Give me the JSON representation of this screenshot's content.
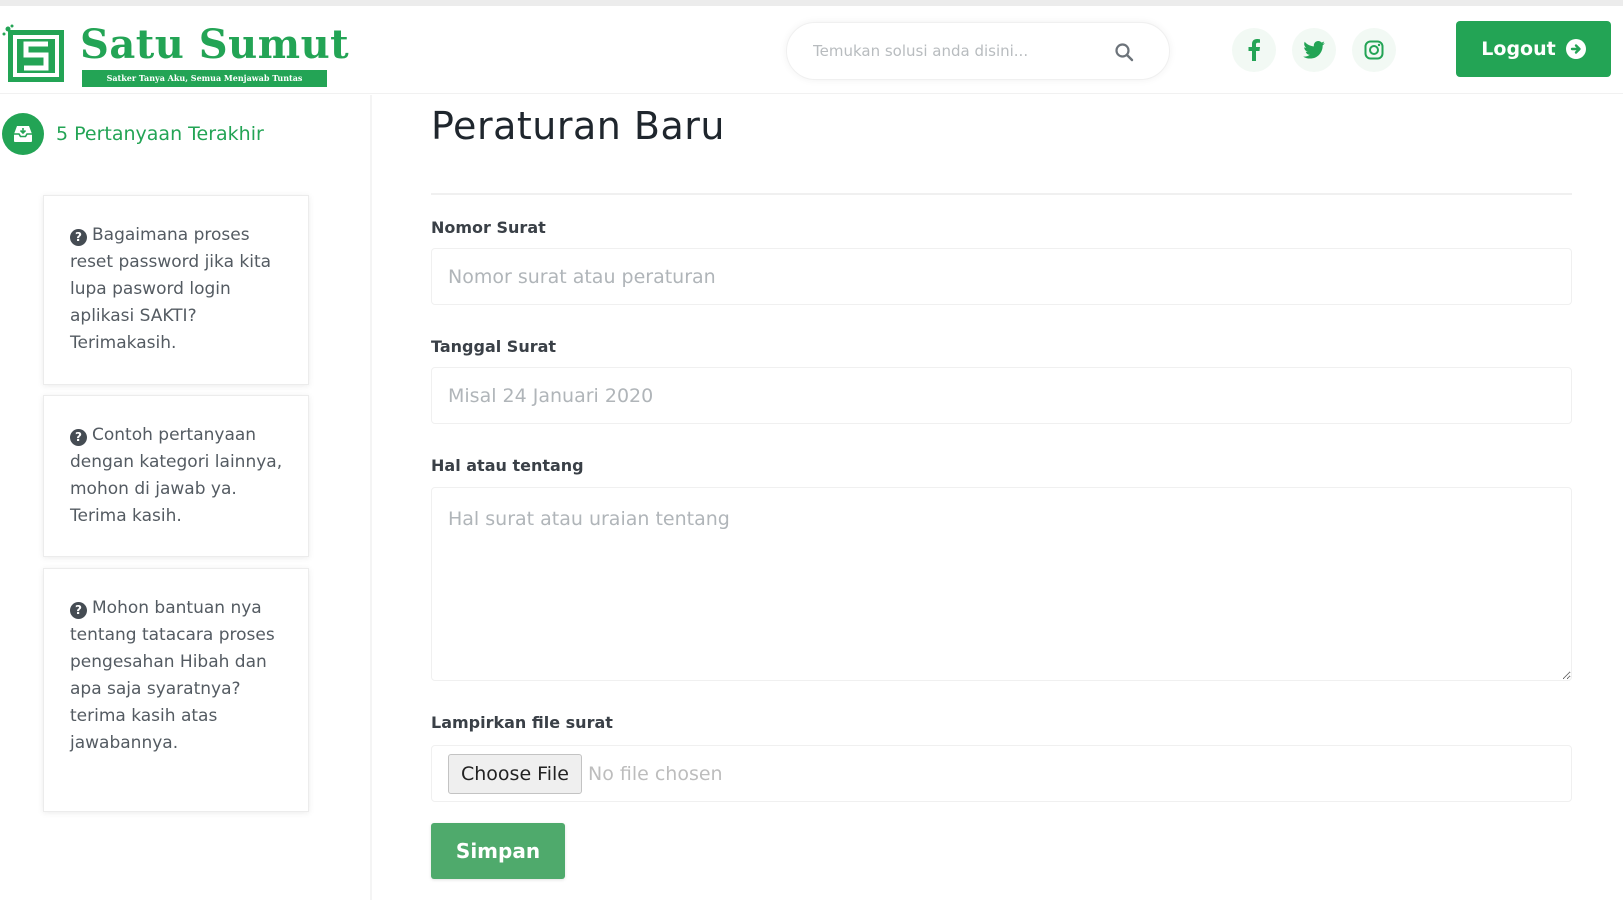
{
  "brand": {
    "title": "Satu Sumut",
    "tagline": "Satker Tanya Aku, Semua Menjawab Tuntas",
    "accent_color": "#23a455"
  },
  "header": {
    "search_placeholder": "Temukan solusi anda disini...",
    "search_icon": "search-icon",
    "social": [
      "facebook-icon",
      "twitter-icon",
      "instagram-icon"
    ],
    "logout_label": "Logout",
    "logout_icon": "arrow-circle-right-icon"
  },
  "sidebar": {
    "heading": "5 Pertanyaan Terakhir",
    "heading_icon": "inbox-icon",
    "questions": [
      "Bagaimana proses reset password jika kita lupa pasword login aplikasi SAKTI? Terimakasih.",
      "Contoh pertanyaan dengan kategori lainnya, mohon di jawab ya. Terima kasih.",
      "Mohon bantuan nya tentang tatacara proses pengesahan Hibah dan apa saja syaratnya? terima kasih atas jawabannya."
    ]
  },
  "form": {
    "title": "Peraturan Baru",
    "nomor_label": "Nomor Surat",
    "nomor_placeholder": "Nomor surat atau peraturan",
    "tanggal_label": "Tanggal Surat",
    "tanggal_placeholder": "Misal 24 Januari 2020",
    "hal_label": "Hal atau tentang",
    "hal_placeholder": "Hal surat atau uraian tentang",
    "file_label": "Lampirkan file surat",
    "file_button": "Choose File",
    "file_status": "No file chosen",
    "submit_label": "Simpan"
  }
}
